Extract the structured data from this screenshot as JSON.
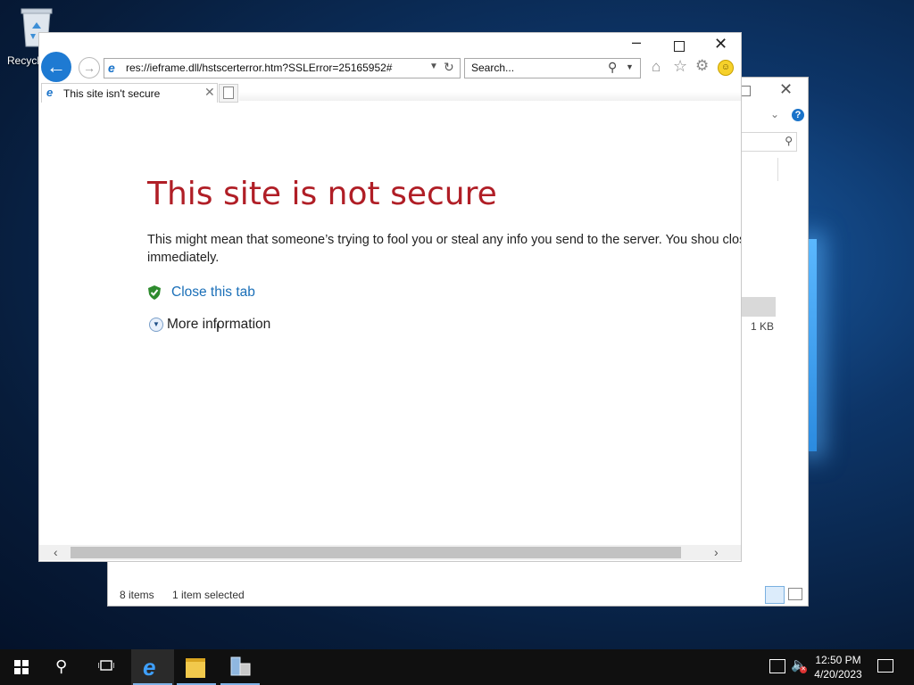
{
  "desktop": {
    "recycle_bin_label": "Recycl"
  },
  "explorer": {
    "file_size": "1 KB",
    "status_items": "8 items",
    "status_selected": "1 item selected"
  },
  "ie": {
    "address_url": "res://ieframe.dll/hstscerterror.htm?SSLError=25165952#",
    "search_placeholder": "Search...",
    "tab_title": "This site isn't secure",
    "heading": "This site is not secure",
    "body": "This might mean that someone’s trying to fool you or steal any info you send to the server. You shou close this site immediately.",
    "close_tab_link": "Close this tab",
    "more_information": "More information"
  },
  "taskbar": {
    "clock_time": "12:50 PM",
    "clock_date": "4/20/2023"
  },
  "colors": {
    "heading_red": "#b01e26",
    "link_blue": "#1a6fb8",
    "accent_blue": "#1e7ad2"
  },
  "icons": [
    "recycle-bin-icon",
    "back-arrow-icon",
    "forward-arrow-icon",
    "ie-icon",
    "refresh-icon",
    "search-icon",
    "home-icon",
    "favorites-star-icon",
    "gear-icon",
    "smiley-feedback-icon",
    "shield-check-icon",
    "expand-chevron-icon",
    "windows-start-icon",
    "taskview-icon",
    "file-explorer-icon",
    "server-manager-icon",
    "network-icon",
    "speaker-muted-icon",
    "notification-icon"
  ]
}
